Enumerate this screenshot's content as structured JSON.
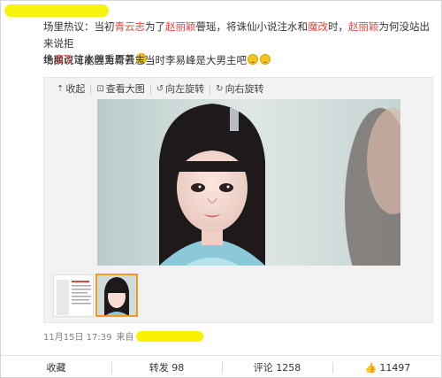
{
  "post": {
    "line1_prefix": "场里热议：当初",
    "line1_name1": "青云志",
    "line1_mid1": "为了",
    "line1_name2": "赵丽颖",
    "line1_mid2": "瞢瑶，将诛仙小说注水和",
    "line1_name3": "魔改",
    "line1_mid3": "时，",
    "line1_name4": "赵丽颖",
    "line1_end": "为何没站出来说拒",
    "line2_prefix": "绝",
    "line2_name": "魔改",
    "line2_end": "注水尊重原著",
    "line3_prefix": "场鹅说可能因为",
    "line3_name": "青云志",
    "line3_end": "当时李易峰是大男主吧"
  },
  "toolbar": {
    "collapse_label": "收起",
    "view_large_label": "查看大图",
    "rotate_left_label": "向左旋转",
    "rotate_right_label": "向右旋转"
  },
  "meta": {
    "timestamp": "11月15日 17:39",
    "source_prefix": "来自"
  },
  "actions": {
    "favorite_label": "收藏",
    "repost_label": "转发 98",
    "comment_label": "评论 1258",
    "like_count": "11497"
  },
  "colors": {
    "highlight": "#f8f200",
    "keyword_red": "#e5463a",
    "thumb_selected": "#f59b1e"
  }
}
